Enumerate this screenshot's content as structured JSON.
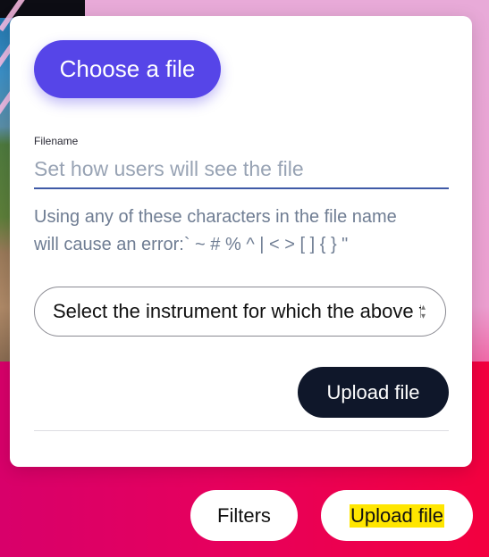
{
  "upload_form": {
    "choose_file_label": "Choose a file",
    "filename_label": "Filename",
    "filename_placeholder": "Set how users will see the file",
    "filename_value": "",
    "hint_line1": "Using any of these characters in the file name",
    "hint_line2": "will cause an error:` ~ # % ^ | < > [ ] { } \"",
    "instrument_select_value": "Select the instrument for which the above file is to be uploaded",
    "upload_label": "Upload file"
  },
  "bottom_bar": {
    "filters_label": "Filters",
    "upload_label": "Upload file"
  },
  "colors": {
    "primary": "#5645e8",
    "dark_button": "#0f172a",
    "highlight": "#ffe600"
  }
}
